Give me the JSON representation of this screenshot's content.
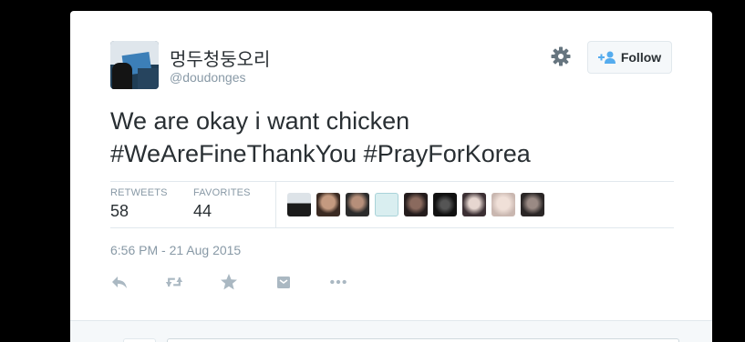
{
  "tweet": {
    "display_name": "멍두청둥오리",
    "screen_name": "@doudonges",
    "text_lines": [
      "We are okay i want chicken",
      "#WeAreFineThankYou #PrayForKorea"
    ],
    "follow_label": "Follow",
    "retweets_label": "RETWEETS",
    "retweets": "58",
    "favorites_label": "FAVORITES",
    "favorites": "44",
    "timestamp": "6:56 PM - 21 Aug 2015"
  },
  "colors": {
    "text": "#292f33",
    "muted": "#8899a6",
    "border": "#e1e8ed",
    "action": "#aab8c2"
  },
  "icons": [
    "gear-icon",
    "follow-user-icon",
    "reply-icon",
    "retweet-icon",
    "favorite-icon",
    "add-to-collection-icon",
    "more-icon"
  ]
}
